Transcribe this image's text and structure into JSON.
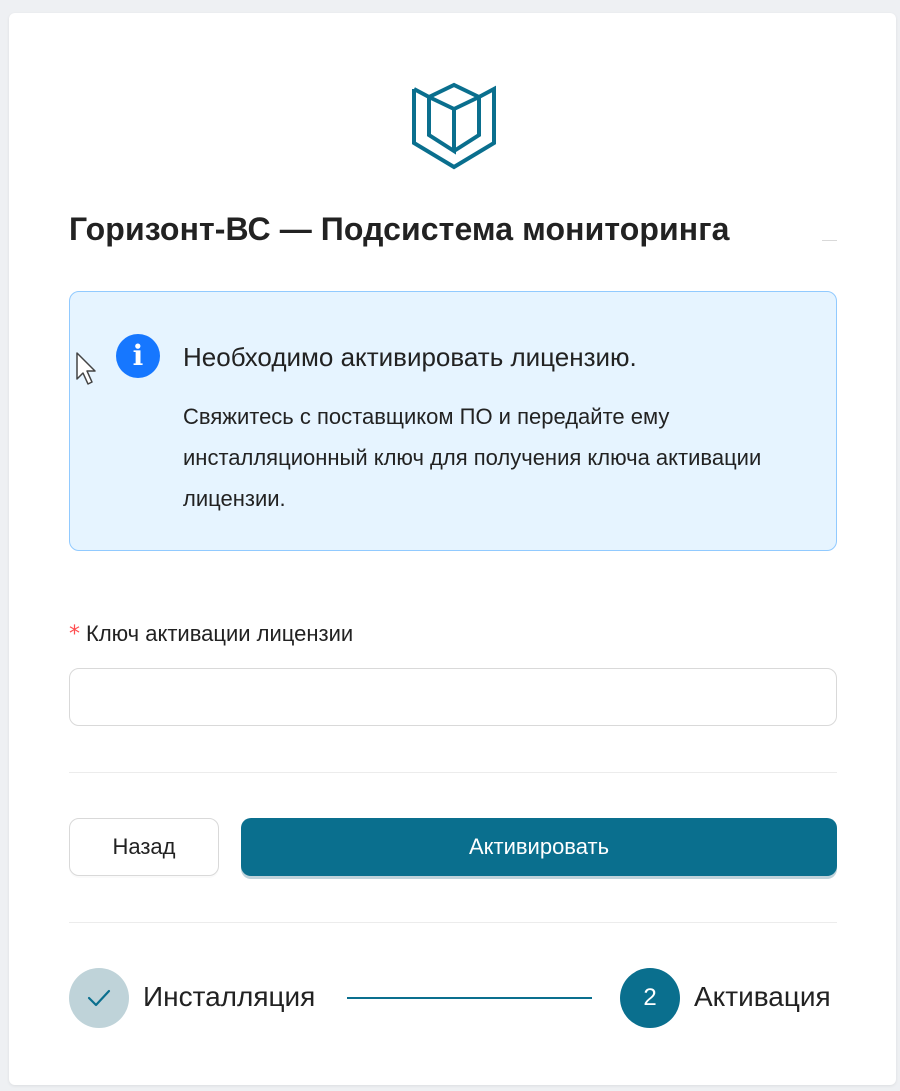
{
  "app": {
    "title": "Горизонт-ВС — Подсистема мониторинга",
    "logo_icon": "book-shield-icon",
    "accent_color": "#0a6f8e"
  },
  "alert": {
    "icon": "info-icon",
    "icon_glyph": "i",
    "title": "Необходимо активировать лицензию.",
    "description": "Свяжитесь с поставщиком ПО и передайте ему инсталляционный ключ для получения ключа активации лицензии.",
    "color": "#1677ff"
  },
  "form": {
    "required_mark": "*",
    "license_key_label": "Ключ активации лицензии",
    "license_key_value": "",
    "license_key_placeholder": ""
  },
  "actions": {
    "back_label": "Назад",
    "activate_label": "Активировать"
  },
  "steps": {
    "items": [
      {
        "label": "Инсталляция",
        "status": "done",
        "icon": "checkmark-icon"
      },
      {
        "label": "Активация",
        "status": "current",
        "number": "2"
      }
    ]
  }
}
